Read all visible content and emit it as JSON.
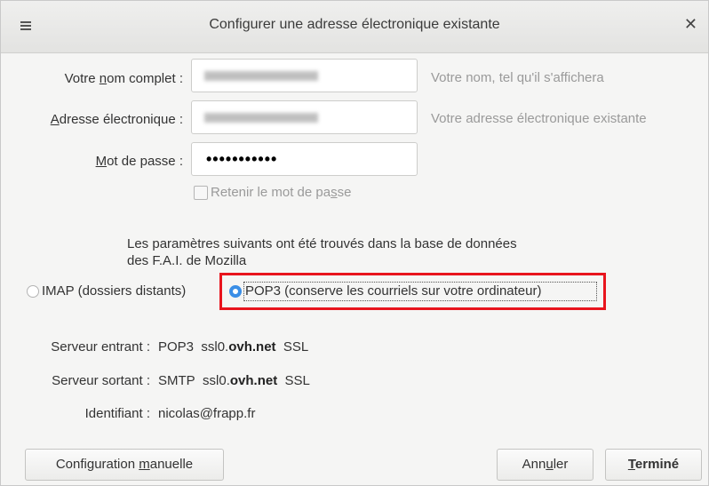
{
  "window": {
    "title": "Configurer une adresse électronique existante"
  },
  "form": {
    "name_label_pre": "Votre ",
    "name_label_u": "n",
    "name_label_post": "om complet :",
    "name_hint": "Votre nom, tel qu'il s'affichera",
    "email_label_u": "A",
    "email_label_post": "dresse électronique :",
    "email_hint": "Votre adresse électronique existante",
    "password_label_u": "M",
    "password_label_post": "ot de passe :",
    "password_value": "•••••••••••",
    "remember_pre": "Retenir le mot de pa",
    "remember_u": "s",
    "remember_post": "se",
    "remember_checked": false
  },
  "info": {
    "line1": "Les paramètres suivants ont été trouvés dans la base de données",
    "line2": "des F.A.I. de Mozilla"
  },
  "protocol": {
    "imap_label": "IMAP (dossiers distants)",
    "pop3_label": "POP3 (conserve les courriels sur votre ordinateur)",
    "selected": "POP3",
    "highlight_color": "#e8141d"
  },
  "servers": {
    "incoming_label": "Serveur entrant :",
    "incoming_type": "POP3",
    "incoming_host_pre": "ssl0.",
    "incoming_host_bold": "ovh.net",
    "incoming_security": "SSL",
    "outgoing_label": "Serveur sortant :",
    "outgoing_type": "SMTP",
    "outgoing_host_pre": "ssl0.",
    "outgoing_host_bold": "ovh.net",
    "outgoing_security": "SSL",
    "identifier_label": "Identifiant :",
    "identifier_value": "nicolas@frapp.fr"
  },
  "buttons": {
    "manual_pre": "Configuration ",
    "manual_u": "m",
    "manual_post": "anuelle",
    "cancel_pre": "Ann",
    "cancel_u": "u",
    "cancel_post": "ler",
    "done_u": "T",
    "done_post": "erminé"
  }
}
